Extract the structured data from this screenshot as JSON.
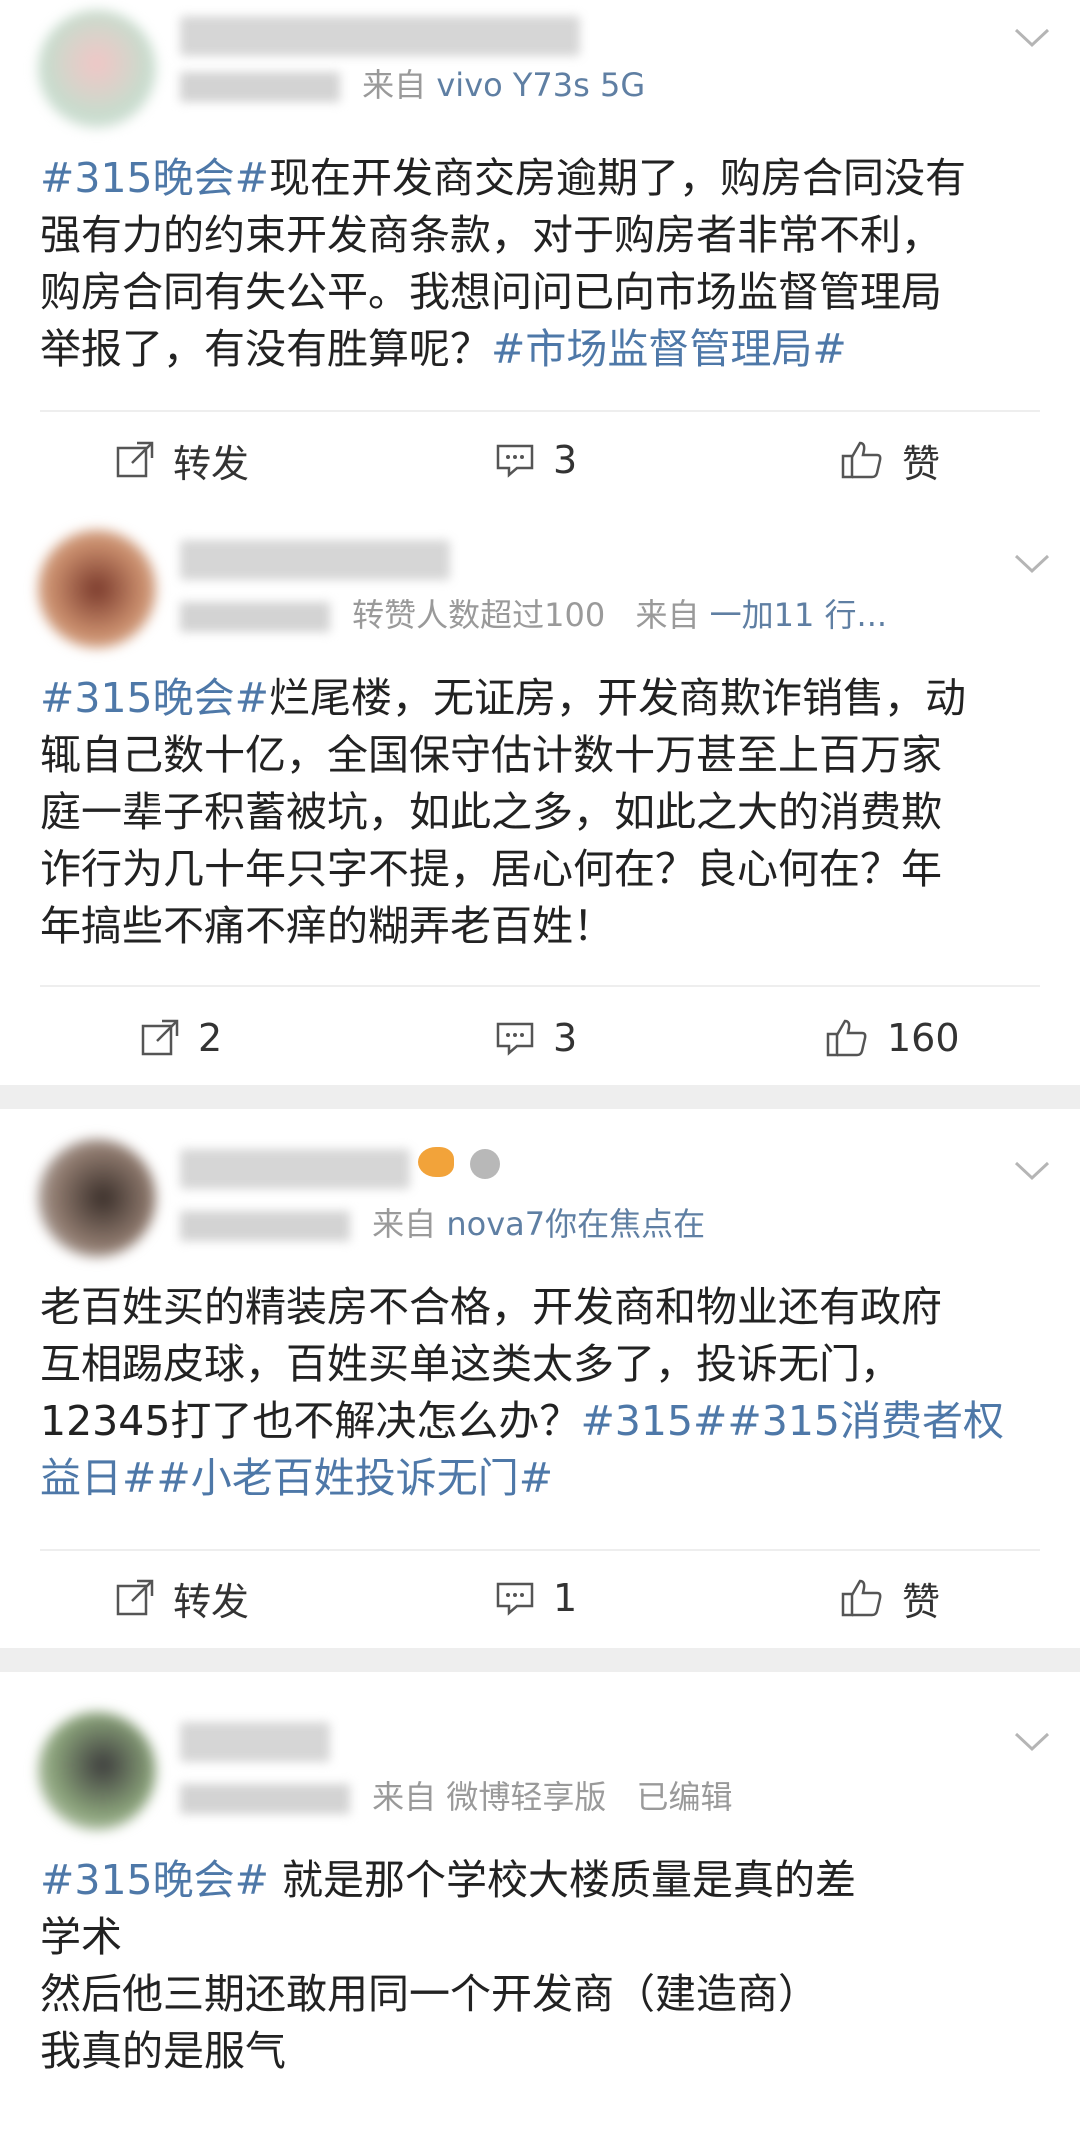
{
  "posts": [
    {
      "meta_text": "",
      "source_prefix": "来自",
      "source": "vivo Y73s 5G",
      "content": [
        {
          "tag": "#315晚会#",
          "text": "现在开发商交房逾期了，购房合同没有"
        },
        {
          "tag": "",
          "text": "强有力的约束开发商条款，对于购房者非常不利，"
        },
        {
          "tag": "",
          "text": "购房合同有失公平。我想问问已向市场监督管理局"
        },
        {
          "tag": "",
          "text": "举报了，有没有胜算呢？",
          "tag2": "#市场监督管理局#"
        }
      ],
      "repost_label": "转发",
      "comment_count": "3",
      "like_label": "赞"
    },
    {
      "meta_text": "转赞人数超过100",
      "source_prefix": "来自",
      "source": "一加11 行...",
      "content": [
        {
          "tag": "#315晚会#",
          "text": "烂尾楼，无证房，开发商欺诈销售，动"
        },
        {
          "tag": "",
          "text": "辄自己数十亿，全国保守估计数十万甚至上百万家"
        },
        {
          "tag": "",
          "text": "庭一辈子积蓄被坑，如此之多，如此之大的消费欺"
        },
        {
          "tag": "",
          "text": "诈行为几十年只字不提，居心何在？良心何在？年"
        },
        {
          "tag": "",
          "text": "年搞些不痛不痒的糊弄老百姓！"
        }
      ],
      "repost_label": "2",
      "comment_count": "3",
      "like_label": "160"
    },
    {
      "meta_text": "",
      "source_prefix": "来自",
      "source": "nova7你在焦点在",
      "content": [
        {
          "tag": "",
          "text": "老百姓买的精装房不合格，开发商和物业还有政府"
        },
        {
          "tag": "",
          "text": "互相踢皮球，百姓买单这类太多了，投诉无门，"
        },
        {
          "tag": "",
          "text": "12345打了也不解决怎么办？",
          "tag2": "#315##315消费者权"
        },
        {
          "tag": "益日##小老百姓投诉无门#",
          "text": ""
        }
      ],
      "repost_label": "转发",
      "comment_count": "1",
      "like_label": "赞"
    },
    {
      "meta_text": "",
      "source_prefix": "来自",
      "source": "微博轻享版",
      "edited": "已编辑",
      "content": [
        {
          "tag": "#315晚会#",
          "text": " 就是那个学校大楼质量是真的差"
        },
        {
          "tag": "",
          "text": "学术"
        },
        {
          "tag": "",
          "text": "然后他三期还敢用同一个开发商（建造商）"
        },
        {
          "tag": "",
          "text": "我真的是服气"
        }
      ]
    }
  ],
  "icons": {
    "repost": "repost-icon",
    "comment": "comment-icon",
    "like": "like-icon",
    "chevron": "chevron-down-icon"
  },
  "colors": {
    "tag": "#4e78a8",
    "source": "#5f7fa3",
    "meta": "#9a9a9a",
    "gap": "#eeeeee"
  }
}
